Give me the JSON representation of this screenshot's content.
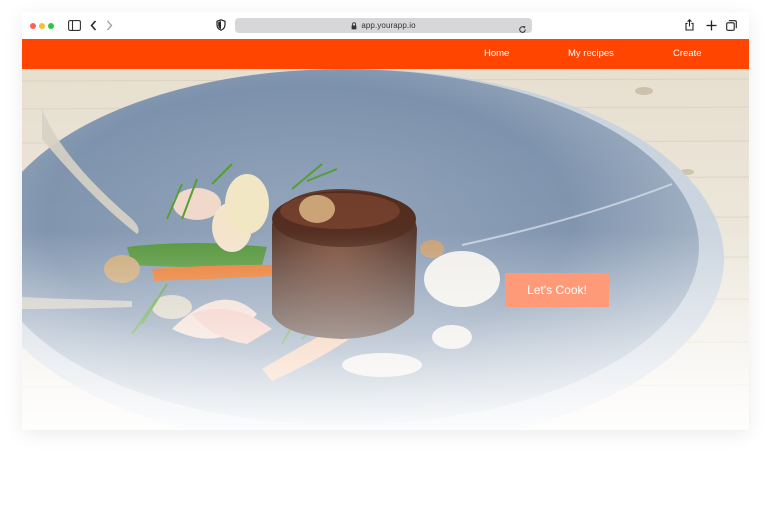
{
  "browser": {
    "url": "app.yourapp.io"
  },
  "nav": {
    "items": [
      {
        "label": "Home"
      },
      {
        "label": "My recipes"
      },
      {
        "label": "Create"
      }
    ]
  },
  "hero": {
    "image": "plated-steak-dish-photo",
    "cta_label": "Let's Cook!"
  },
  "colors": {
    "nav_bg": "#ff4500",
    "cta_bg": "#ff9a78"
  }
}
